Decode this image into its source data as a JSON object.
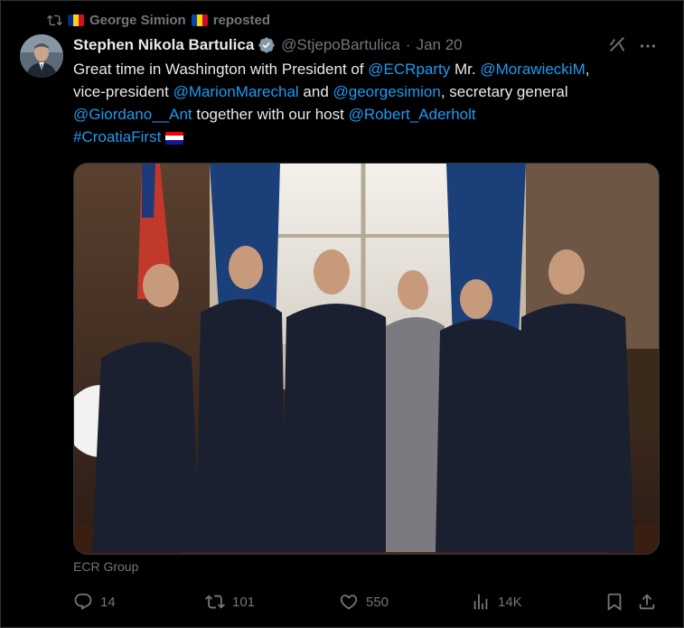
{
  "repost": {
    "user": "George Simion",
    "label": "reposted"
  },
  "author": {
    "name": "Stephen Nikola Bartulica",
    "handle": "@StjepoBartulica",
    "separator": "·",
    "date": "Jan 20"
  },
  "tweet": {
    "t1": "Great time in Washington with President of ",
    "m1": "@ECRparty",
    "t2": " Mr. ",
    "m2": "@MorawieckiM",
    "t3": ",",
    "t4": "vice-president ",
    "m3": "@MarionMarechal",
    "t5": " and ",
    "m4": "@georgesimion",
    "t6": ", secretary general",
    "m5": "@Giordano__Ant",
    "t7": " together with our host ",
    "m6": "@Robert_Aderholt",
    "m7": "#CroatiaFirst"
  },
  "media_source": "ECR Group",
  "metrics": {
    "replies": "14",
    "reposts": "101",
    "likes": "550",
    "views": "14K"
  },
  "colors": {
    "accent": "#1d9bf0",
    "text": "#e7e9ea",
    "muted": "#71767b",
    "background": "#000000"
  },
  "icons": [
    "repost-icon",
    "romania-flag-icon",
    "moldova-flag-icon",
    "verified-badge-icon",
    "grok-icon",
    "more-icon",
    "croatia-flag-icon",
    "reply-icon",
    "retweet-icon",
    "like-icon",
    "views-icon",
    "bookmark-icon",
    "share-icon"
  ]
}
